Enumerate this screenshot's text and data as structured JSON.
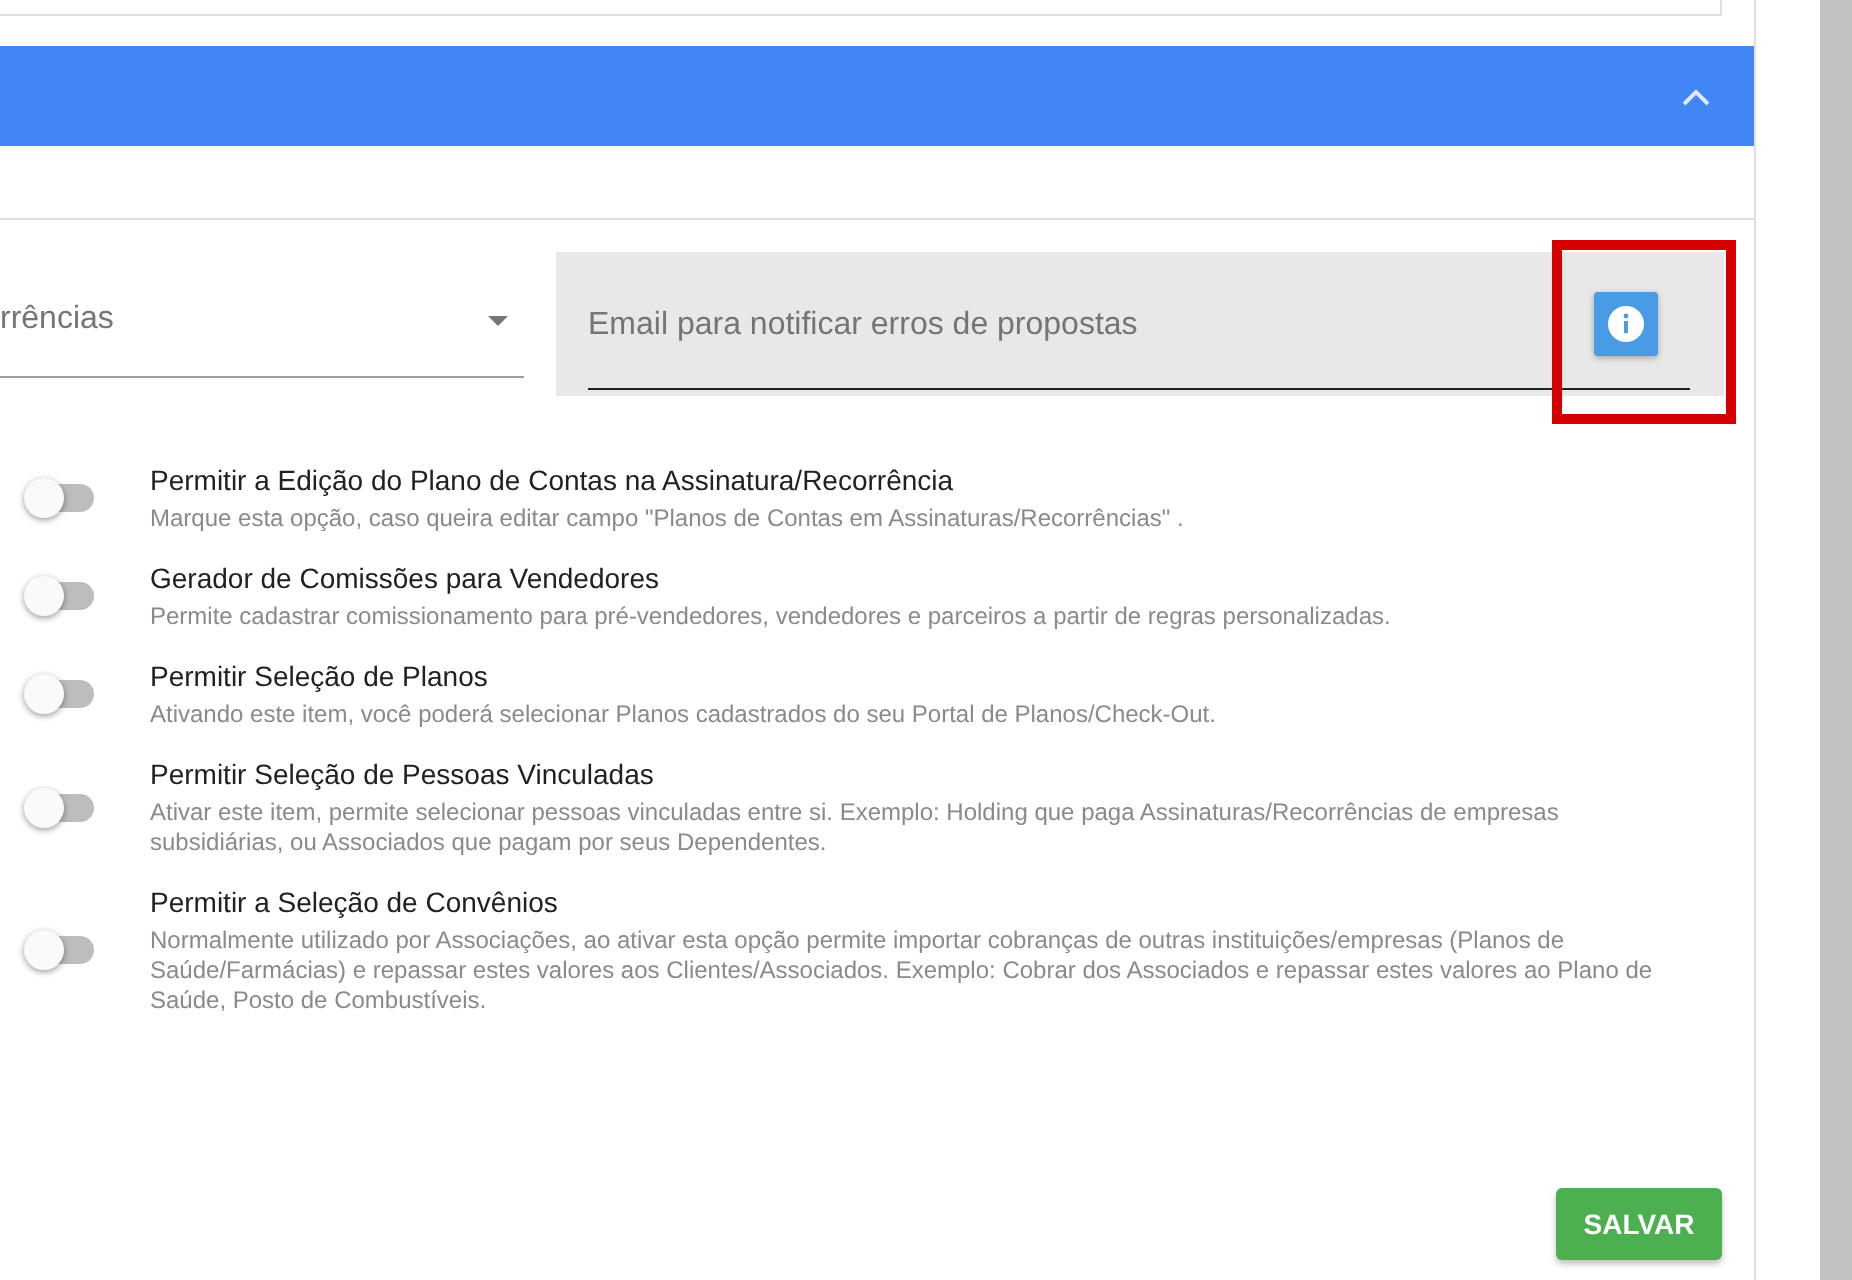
{
  "panel": {
    "expanded": true
  },
  "select": {
    "value": "rrências"
  },
  "email": {
    "placeholder": "Email para notificar erros de propostas",
    "highlighted": true
  },
  "options": [
    {
      "title": "Permitir a Edição do Plano de Contas na Assinatura/Recorrência",
      "description": "Marque esta opção, caso queira editar campo \"Planos de Contas em Assinaturas/Recorrências\" .",
      "on": false
    },
    {
      "title": "Gerador de Comissões para Vendedores",
      "description": "Permite cadastrar comissionamento para pré-vendedores, vendedores e parceiros a partir de regras personalizadas.",
      "on": false
    },
    {
      "title": "Permitir Seleção de Planos",
      "description": "Ativando este item, você poderá selecionar Planos cadastrados do seu Portal de Planos/Check-Out.",
      "on": false
    },
    {
      "title": "Permitir Seleção de Pessoas Vinculadas",
      "description": "Ativar este item, permite selecionar pessoas vinculadas entre si. Exemplo: Holding que paga Assinaturas/Recorrências de empresas subsidiárias, ou Associados que pagam por seus Dependentes.",
      "on": false
    },
    {
      "title": "Permitir a Seleção de Convênios",
      "description": "Normalmente utilizado por Associações, ao ativar esta opção permite importar cobranças de outras instituições/empresas (Planos de Saúde/Farmácias) e repassar estes valores aos Clientes/Associados. Exemplo: Cobrar dos Associados e repassar estes valores ao Plano de Saúde, Posto de Combustíveis.",
      "on": false
    }
  ],
  "save_button": "SALVAR"
}
